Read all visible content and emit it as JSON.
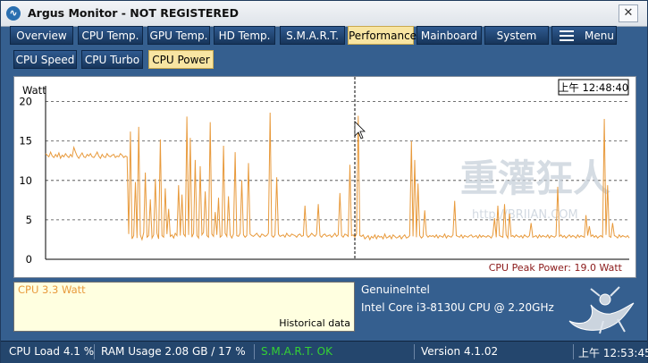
{
  "window": {
    "title": "Argus Monitor - NOT REGISTERED"
  },
  "tabs": [
    {
      "label": "Overview",
      "active": false
    },
    {
      "label": "CPU Temp.",
      "active": false
    },
    {
      "label": "GPU Temp.",
      "active": false
    },
    {
      "label": "HD Temp.",
      "active": false
    },
    {
      "label": "S.M.A.R.T.",
      "active": false
    },
    {
      "label": "Performance",
      "active": true
    },
    {
      "label": "Mainboard",
      "active": false
    },
    {
      "label": "System",
      "active": false
    }
  ],
  "menu": {
    "label": "Menu"
  },
  "subtabs": [
    {
      "label": "CPU Speed",
      "active": false
    },
    {
      "label": "CPU Turbo",
      "active": false
    },
    {
      "label": "CPU Power",
      "active": true
    }
  ],
  "chart": {
    "time_label": "上午 12:48:40",
    "peak_label": "CPU Peak Power: 19.0 Watt",
    "watermark_main": "重灌狂人",
    "watermark_url": "http://BRIIAN.COM"
  },
  "chart_data": {
    "type": "line",
    "ylabel": "Watt",
    "ylim": [
      0,
      22
    ],
    "yticks": [
      0,
      5,
      10,
      15,
      20
    ],
    "grid": true,
    "series": [
      {
        "color": "#e89a3c",
        "values": [
          13.4,
          13.2,
          13.0,
          13.6,
          13.1,
          12.9,
          13.3,
          13.0,
          13.5,
          12.8,
          13.2,
          13.0,
          13.4,
          13.1,
          12.9,
          13.3,
          13.0,
          14.2,
          13.6,
          13.1,
          12.8,
          13.2,
          13.5,
          13.0,
          12.9,
          13.3,
          13.1,
          13.4,
          13.0,
          12.9,
          13.2,
          13.6,
          13.1,
          12.8,
          13.3,
          13.0,
          12.9,
          13.4,
          13.1,
          13.0,
          13.2,
          13.3,
          12.9,
          13.1,
          13.0,
          13.4,
          13.2,
          12.9,
          13.1,
          13.0,
          3.2,
          16.2,
          2.6,
          3.0,
          9.8,
          2.7,
          16.8,
          3.1,
          2.5,
          3.4,
          11.0,
          2.8,
          3.0,
          7.6,
          2.7,
          3.1,
          10.2,
          3.3,
          2.6,
          15.2,
          3.0,
          2.8,
          9.0,
          3.2,
          6.4,
          2.9,
          3.1,
          2.7,
          3.3,
          3.0,
          9.4,
          3.0,
          8.2,
          3.2,
          2.9,
          18.1,
          3.1,
          15.4,
          2.8,
          3.3,
          12.6,
          3.0,
          2.7,
          11.8,
          3.1,
          3.4,
          8.6,
          3.0,
          2.8,
          17.4,
          3.2,
          2.9,
          6.0,
          3.1,
          7.8,
          2.8,
          3.0,
          14.4,
          3.3,
          2.9,
          8.0,
          3.1,
          2.7,
          3.2,
          13.6,
          3.0,
          2.9,
          3.3,
          10.0,
          3.1,
          2.8,
          3.0,
          12.2,
          3.2,
          3.0,
          2.9,
          3.1,
          3.3,
          3.0,
          2.8,
          3.2,
          3.1,
          2.9,
          3.0,
          3.3,
          18.6,
          3.0,
          2.8,
          3.1,
          10.4,
          3.2,
          2.9,
          3.0,
          3.1,
          2.8,
          3.3,
          3.0,
          2.9,
          3.2,
          3.1,
          3.0,
          2.8,
          3.1,
          3.2,
          2.9,
          3.0,
          6.8,
          3.1,
          2.8,
          3.0,
          3.3,
          3.1,
          2.9,
          3.2,
          7.0,
          3.0,
          2.8,
          3.1,
          3.2,
          2.9,
          3.0,
          3.1,
          2.8,
          3.0,
          3.3,
          2.9,
          3.1,
          8.4,
          3.0,
          2.8,
          3.2,
          3.1,
          2.9,
          12.0,
          3.0,
          3.1,
          2.8,
          3.2,
          18.2,
          3.0,
          2.9,
          3.1,
          2.6,
          2.8,
          3.0,
          2.5,
          2.9,
          2.7,
          3.1,
          2.6,
          3.0,
          2.8,
          2.9,
          2.6,
          3.2,
          2.7,
          2.8,
          3.0,
          2.6,
          3.1,
          2.9,
          2.7,
          2.8,
          3.0,
          2.6,
          2.9,
          3.1,
          2.7,
          2.8,
          3.0,
          15.0,
          2.9,
          12.6,
          2.8,
          9.6,
          3.0,
          2.7,
          2.9,
          6.2,
          3.1,
          2.8,
          3.0,
          2.9,
          3.0,
          2.8,
          3.1,
          2.7,
          3.0,
          2.9,
          2.8,
          3.2,
          2.7,
          3.0,
          2.9,
          2.8,
          3.1,
          7.4,
          3.0,
          2.9,
          2.8,
          3.1,
          2.7,
          3.0,
          2.9,
          2.8,
          3.0,
          3.1,
          2.8,
          2.9,
          3.0,
          2.7,
          3.1,
          2.8,
          3.0,
          2.9,
          2.8,
          3.0,
          2.9,
          2.7,
          3.1,
          5.2,
          2.8,
          6.8,
          3.0,
          2.9,
          2.8,
          7.0,
          3.1,
          2.7,
          5.8,
          2.9,
          3.0,
          2.8,
          3.1,
          2.9,
          2.8,
          3.0,
          2.7,
          3.1,
          2.9,
          2.8,
          3.0,
          4.6,
          2.8,
          2.9,
          3.0,
          2.7,
          3.1,
          2.8,
          3.0,
          2.9,
          2.8,
          3.1,
          2.7,
          3.0,
          2.9,
          2.8,
          3.0,
          9.2,
          2.9,
          3.1,
          2.8,
          3.0,
          2.7,
          2.9,
          3.1,
          2.8,
          3.0,
          2.9,
          2.7,
          3.1,
          2.8,
          3.0,
          2.9,
          2.8,
          5.6,
          3.0,
          4.2,
          2.9,
          3.1,
          2.8,
          3.0,
          2.7,
          2.9,
          3.0,
          2.8,
          17.8,
          3.1,
          9.4,
          2.9,
          2.8,
          4.6,
          3.0,
          2.9,
          2.7,
          3.1,
          2.8,
          3.0,
          2.9,
          2.8,
          3.0,
          2.7
        ]
      }
    ]
  },
  "info_box": {
    "cpu_value": "CPU 3.3 Watt",
    "historical": "Historical data"
  },
  "cpu_info": {
    "vendor": "GenuineIntel",
    "model": "Intel Core i3-8130U CPU @ 2.20GHz"
  },
  "status": {
    "cpu_load": "CPU Load 4.1 %",
    "ram_usage": "RAM Usage 2.08 GB / 17 %",
    "smart": "S.M.A.R.T. OK",
    "version": "Version 4.1.02",
    "clock": "上午 12:53:45"
  },
  "colors": {
    "accent_orange": "#e89a3c",
    "peak_red": "#8b1a1a",
    "smart_ok": "#34d234"
  }
}
